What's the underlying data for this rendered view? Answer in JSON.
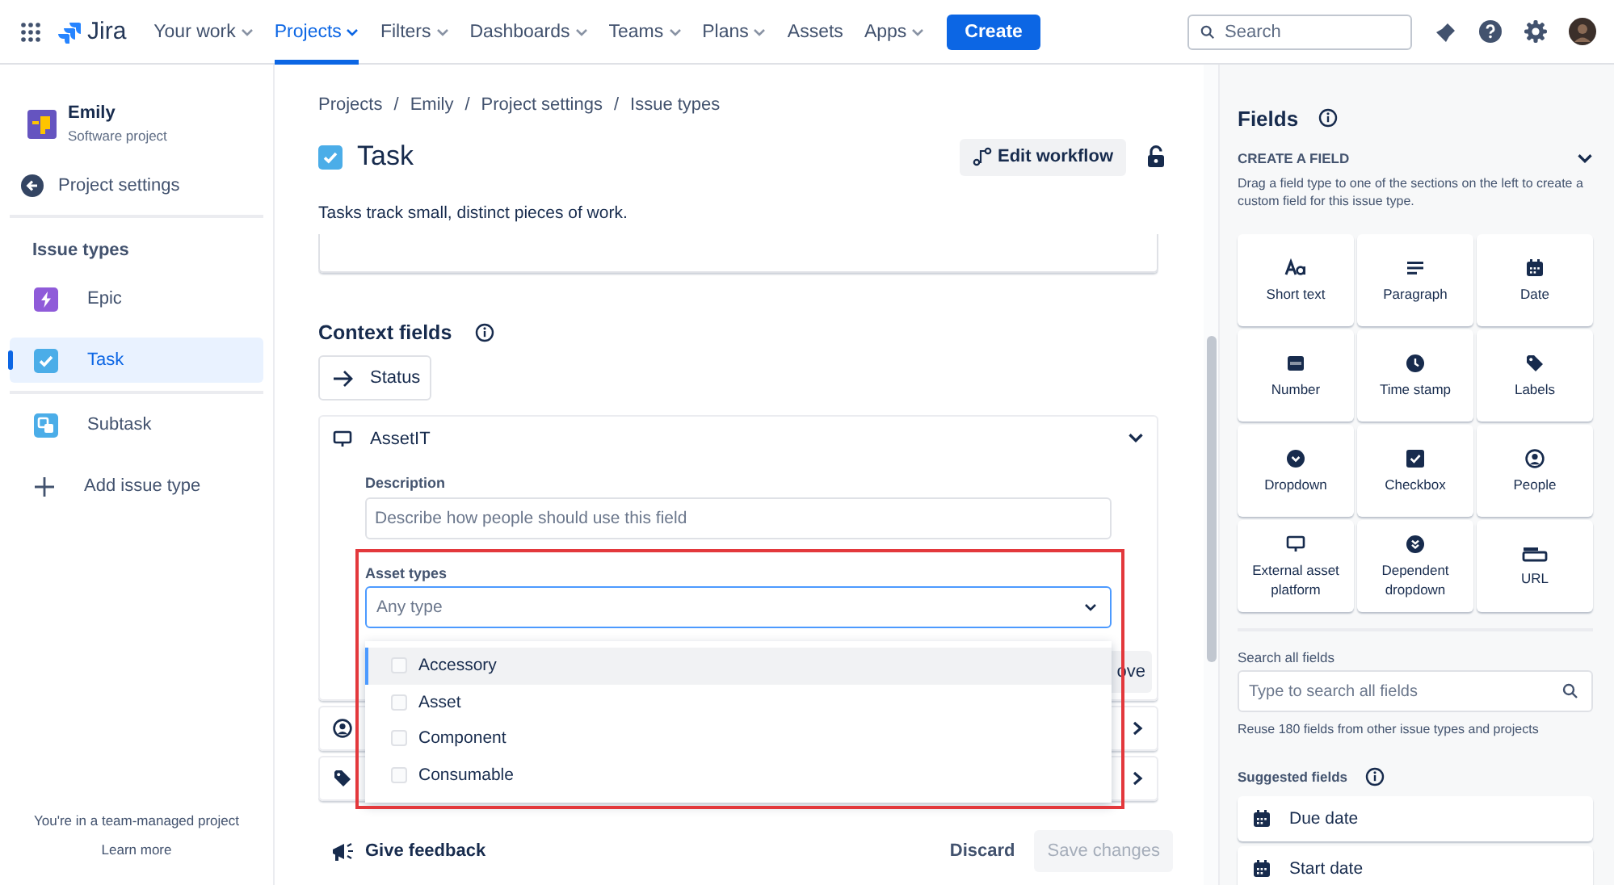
{
  "nav": {
    "product": "Jira",
    "menus": [
      {
        "label": "Your work",
        "dropdown": true,
        "selected": false
      },
      {
        "label": "Projects",
        "dropdown": true,
        "selected": true
      },
      {
        "label": "Filters",
        "dropdown": true,
        "selected": false
      },
      {
        "label": "Dashboards",
        "dropdown": true,
        "selected": false
      },
      {
        "label": "Teams",
        "dropdown": true,
        "selected": false
      },
      {
        "label": "Plans",
        "dropdown": true,
        "selected": false
      },
      {
        "label": "Assets",
        "dropdown": false,
        "selected": false
      },
      {
        "label": "Apps",
        "dropdown": true,
        "selected": false
      }
    ],
    "create": "Create",
    "search": {
      "placeholder": "Search"
    }
  },
  "sidebar": {
    "project": {
      "name": "Emily",
      "type": "Software project"
    },
    "back": "Project settings",
    "section": "Issue types",
    "items": [
      {
        "label": "Epic",
        "kind": "epic",
        "selected": false
      },
      {
        "label": "Task",
        "kind": "task",
        "selected": true
      },
      {
        "label": "Subtask",
        "kind": "subtask",
        "selected": false
      }
    ],
    "add": "Add issue type",
    "note": "You're in a team-managed project",
    "link": "Learn more"
  },
  "main": {
    "breadcrumbs": [
      {
        "label": "Projects"
      },
      {
        "separator": "/",
        "label": "Emily"
      },
      {
        "separator": "/",
        "label": "Project settings"
      },
      {
        "separator": "/",
        "label": "Issue types"
      }
    ],
    "title": "Task",
    "edit_workflow": "Edit workflow",
    "description": "Tasks track small, distinct pieces of work.",
    "context_heading": "Context fields",
    "status_button": "Status",
    "field": {
      "name": "AssetIT",
      "expanded": true,
      "description": {
        "label": "Description",
        "placeholder": "Describe how people should use this field"
      },
      "asset_types": {
        "label": "Asset types",
        "placeholder": "Any type"
      },
      "partial_button": "ove",
      "options": [
        {
          "label": "Accessory",
          "checked": false,
          "selected": true
        },
        {
          "label": "Asset",
          "checked": false,
          "selected": false
        },
        {
          "label": "Component",
          "checked": false,
          "selected": false
        },
        {
          "label": "Consumable",
          "checked": false,
          "selected": false
        }
      ]
    },
    "feedback": "Give feedback",
    "discard": "Discard",
    "save": {
      "label": "Save changes",
      "disabled": true
    }
  },
  "fields_panel": {
    "title": "Fields",
    "create_heading": "CREATE A FIELD",
    "create_help": "Drag a field type to one of the sections on the left to create a custom field for this issue type.",
    "types": [
      {
        "label": "Short text",
        "kind": "short_text"
      },
      {
        "label": "Paragraph",
        "kind": "paragraph"
      },
      {
        "label": "Date",
        "kind": "date"
      },
      {
        "label": "Number",
        "kind": "number"
      },
      {
        "label": "Time stamp",
        "kind": "timestamp"
      },
      {
        "label": "Labels",
        "kind": "labels"
      },
      {
        "label": "Dropdown",
        "kind": "dropdown"
      },
      {
        "label": "Checkbox",
        "kind": "checkbox"
      },
      {
        "label": "People",
        "kind": "people"
      },
      {
        "label": "External asset platform",
        "kind": "asset"
      },
      {
        "label": "Dependent dropdown",
        "kind": "dependent"
      },
      {
        "label": "URL",
        "kind": "url"
      }
    ],
    "search_label": "Search all fields",
    "search": {
      "placeholder": "Type to search all fields"
    },
    "reuse_note": "Reuse 180 fields from other issue types and projects",
    "suggested_heading": "Suggested fields",
    "suggested": [
      "Due date",
      "Start date"
    ]
  }
}
